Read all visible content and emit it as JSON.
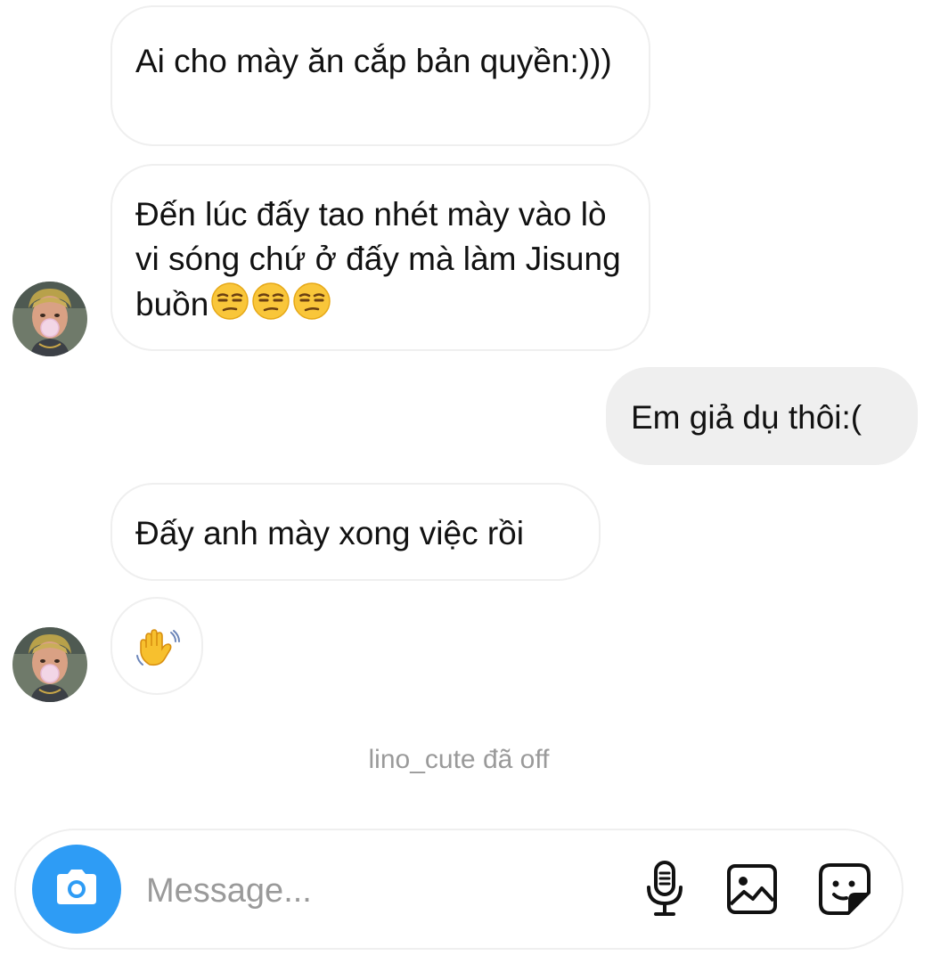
{
  "conversation": {
    "messages": [
      {
        "direction": "incoming",
        "text": "Ai cho mày ăn cắp bản quyền:)))"
      },
      {
        "direction": "incoming",
        "text": "Đến lúc đấy tao nhét mày vào lò vi sóng chứ ở đấy mà làm Jisung buồn",
        "emoji": [
          "unamused-face",
          "unamused-face",
          "unamused-face"
        ]
      },
      {
        "direction": "outgoing",
        "text": "Em giả dụ thôi:("
      },
      {
        "direction": "incoming",
        "text": "Đấy anh mày xong việc rồi"
      },
      {
        "direction": "incoming",
        "emoji": [
          "waving-hand"
        ]
      }
    ],
    "status_text": "lino_cute đã off"
  },
  "composer": {
    "placeholder": "Message...",
    "icons": [
      "camera-icon",
      "microphone-icon",
      "image-gallery-icon",
      "sticker-icon"
    ]
  },
  "colors": {
    "incoming_border": "#efefef",
    "outgoing_bubble": "#efefef",
    "camera_button": "#2e9cf5",
    "status_text": "#9a9a9a"
  }
}
